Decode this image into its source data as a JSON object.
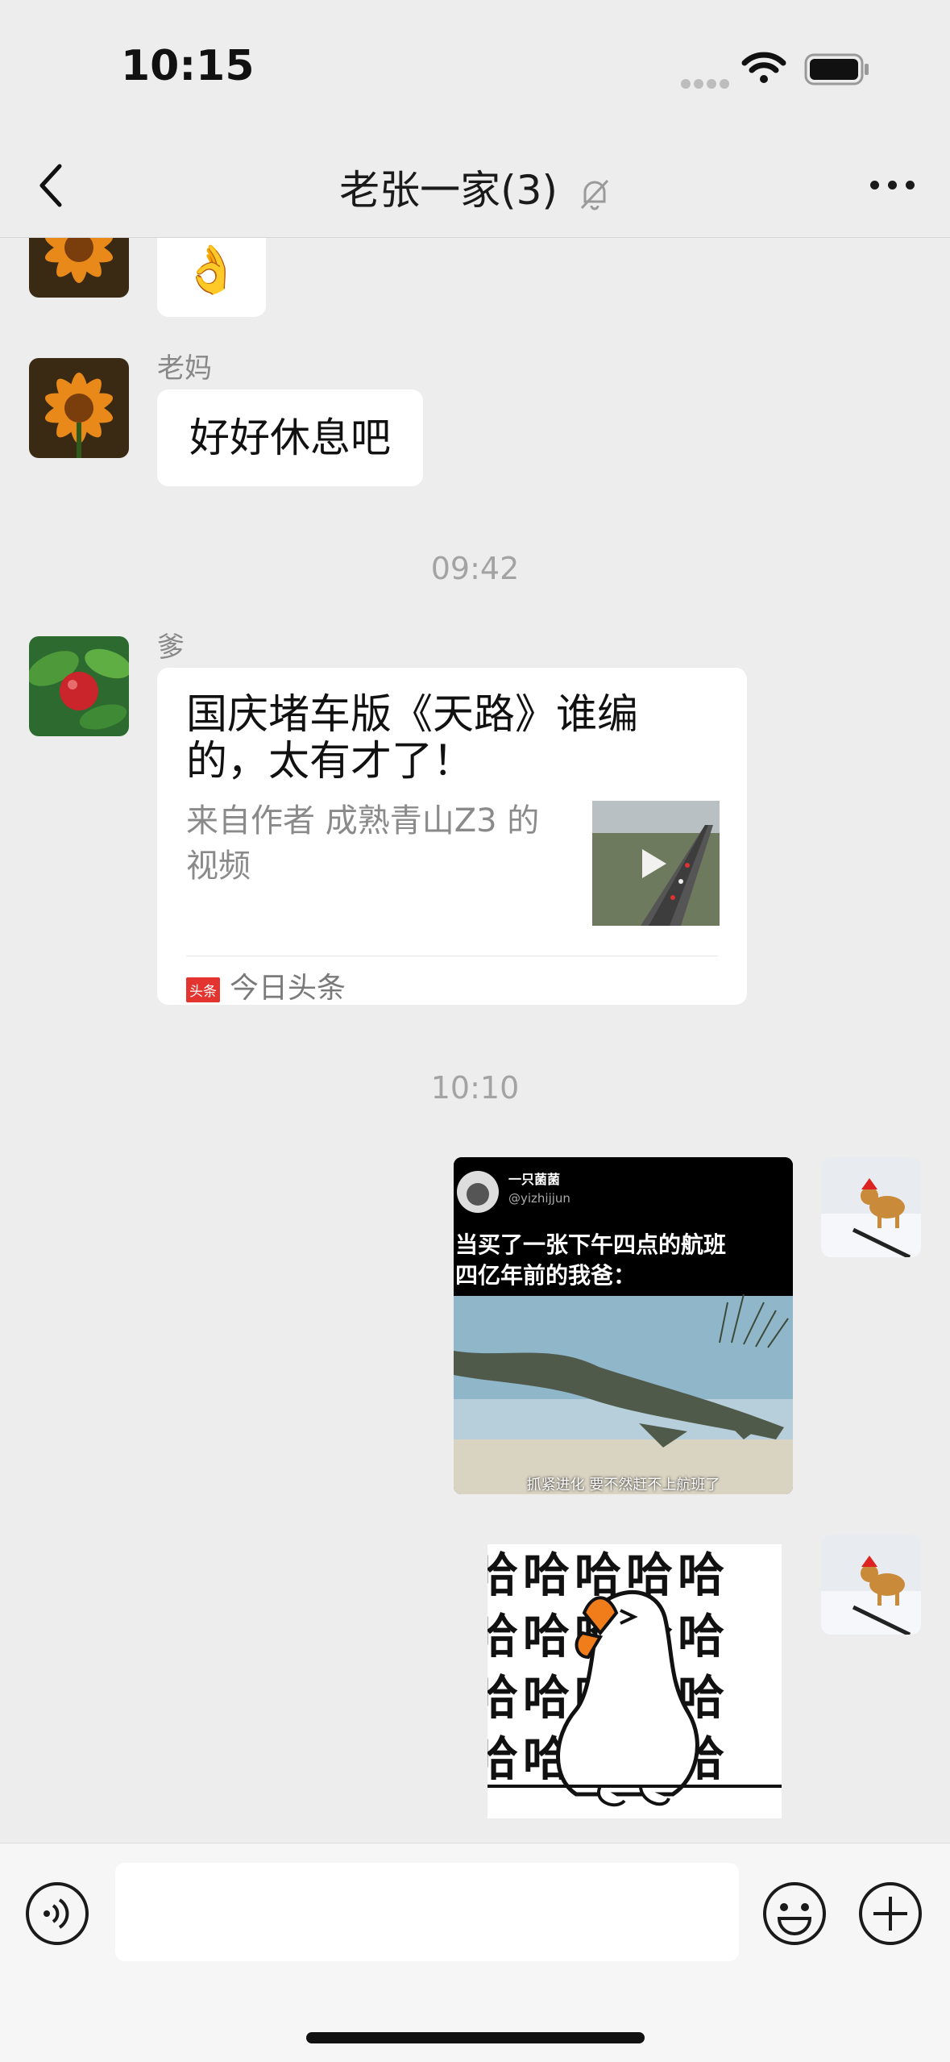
{
  "status_bar": {
    "time": "10:15"
  },
  "header": {
    "title": "老张一家(3)"
  },
  "messages": [
    {
      "type": "emoji-text",
      "content": "👌"
    },
    {
      "sender": "老妈",
      "text": "好好休息吧"
    },
    {
      "type": "timestamp",
      "text": "09:42"
    },
    {
      "sender": "爹",
      "type": "link",
      "title": "国庆堵车版《天路》谁编的，太有才了！",
      "subtitle": "来自作者 成熟青山Z3 的视频",
      "source_logo": "头条",
      "source": "今日头条"
    },
    {
      "type": "timestamp",
      "text": "10:10"
    },
    {
      "type": "image",
      "author_name": "一只菌菌",
      "author_handle": "@yizhijjun",
      "caption": "当买了一张下午四点的航班\n四亿年前的我爸：",
      "bottom_caption": "抓紧进化 要不然赶不上航班了"
    },
    {
      "type": "sticker",
      "glyph": "哈"
    }
  ],
  "icons": {
    "back": "chevron-left-icon",
    "mute": "bell-slash-icon",
    "more": "more-dots-icon",
    "voice": "voice-icon",
    "emoji": "emoji-icon",
    "plus": "plus-icon"
  }
}
